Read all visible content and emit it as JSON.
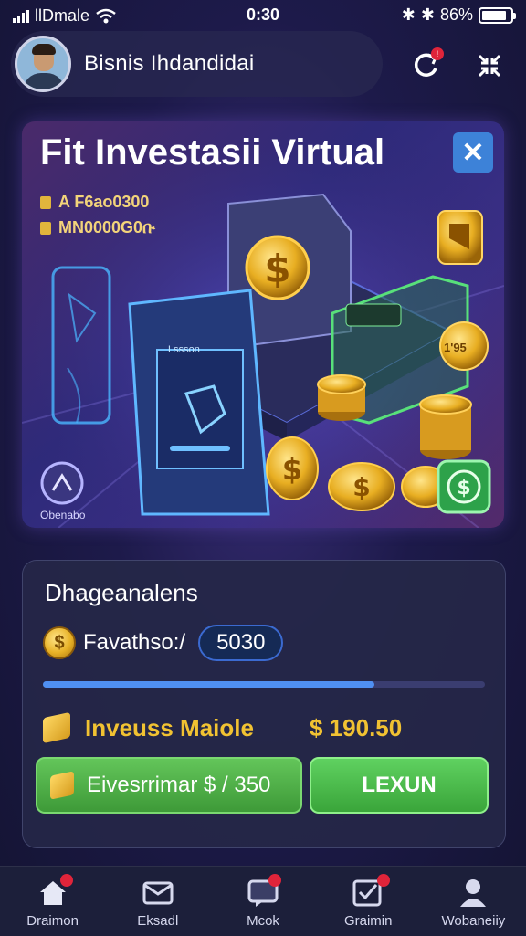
{
  "status_bar": {
    "carrier": "llDmale",
    "time": "0:30",
    "battery": "86%",
    "battery_level": 0.86
  },
  "header": {
    "user_name": "Bisnis Ihdandidai",
    "notification_count": "!"
  },
  "hero": {
    "title": "Fit Investasii Virtual",
    "close_label": "✕",
    "stat_1": "A F6ao0300",
    "stat_2": "MN0000G0ቡ",
    "screen_label": "Lssson",
    "badge_label": "Obenabo",
    "price_tag": "1'95"
  },
  "panel": {
    "title": "Dhageanalens",
    "balance_label": "Favathso:/",
    "balance_value": "5030",
    "progress": 0.75,
    "investment_label": "Inveuss Maiole",
    "investment_value": "$ 190.50",
    "invest_button_label": "Eivesrrimar $ / 350",
    "go_button_label": "LEXUN"
  },
  "nav": {
    "items": [
      {
        "label": "Draimon",
        "icon": "home-icon"
      },
      {
        "label": "Eksadl",
        "icon": "mail-icon"
      },
      {
        "label": "Mcok",
        "icon": "chat-icon"
      },
      {
        "label": "Graimin",
        "icon": "check-icon"
      },
      {
        "label": "Wobaneiiy",
        "icon": "profile-icon"
      }
    ]
  },
  "colors": {
    "accent_gold": "#f1c232",
    "accent_green": "#4caf50",
    "accent_blue": "#3d82d8",
    "badge_red": "#e0243a"
  }
}
